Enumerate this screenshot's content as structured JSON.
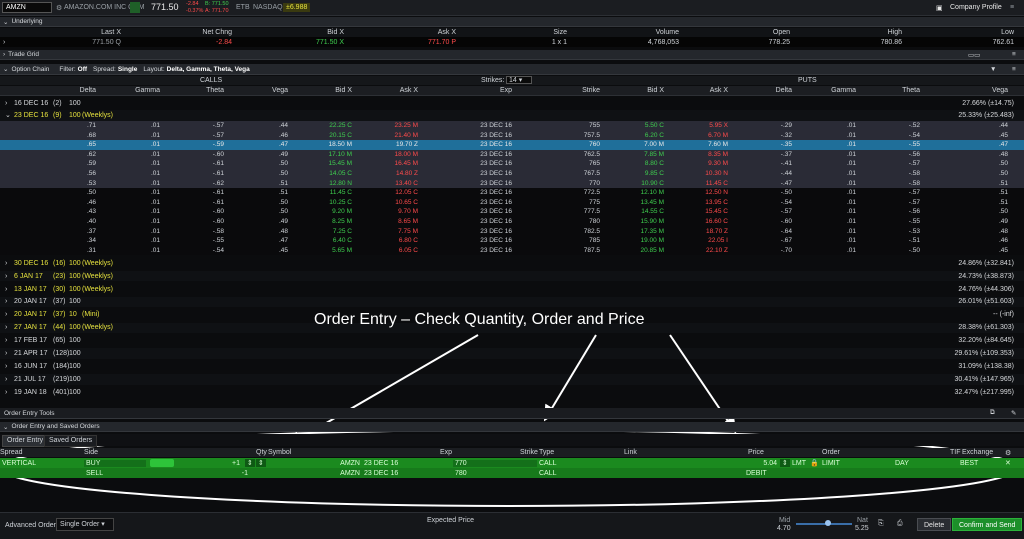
{
  "topbar": {
    "symbol": "AMZN",
    "company": "AMAZON.COM INC COM",
    "last": "771.50",
    "change_line1": "-2.84",
    "change_line2": "-0.37%",
    "bid_small": "B: 771.50",
    "ask_small": "A: 771.70",
    "etb": "ETB",
    "exchange": "NASDAQ",
    "pl_badge": "±6.988",
    "company_profile": "Company Profile"
  },
  "underlying": {
    "title": "Underlying",
    "headers": [
      "Last X",
      "Net Chng",
      "Bid X",
      "Ask X",
      "Size",
      "Volume",
      "Open",
      "High",
      "Low"
    ],
    "values": [
      "771.50 Q",
      "-2.84",
      "771.50 X",
      "771.70 P",
      "1 x 1",
      "4,768,053",
      "778.25",
      "780.86",
      "762.61"
    ]
  },
  "trade_grid": {
    "title": "Trade Grid"
  },
  "option_chain": {
    "title": "Option Chain",
    "filter_label": "Filter:",
    "filter_value": "Off",
    "spread_label": "Spread:",
    "spread_value": "Single",
    "layout_label": "Layout:",
    "layout_value": "Delta, Gamma, Theta, Vega",
    "calls_label": "CALLS",
    "puts_label": "PUTS",
    "strikes_label": "Strikes:",
    "strikes_value": "14",
    "call_headers": [
      "Delta",
      "Gamma",
      "Theta",
      "Vega",
      "Bid X",
      "Ask X"
    ],
    "mid_headers": [
      "Exp",
      "Strike"
    ],
    "put_headers": [
      "Bid X",
      "Ask X",
      "Delta",
      "Gamma",
      "Theta",
      "Vega"
    ]
  },
  "expirations_top": [
    {
      "label": "16 DEC 16",
      "days": "(2)",
      "mult": "100",
      "tag": "",
      "iv": "27.66% (±14.75)"
    },
    {
      "label": "23 DEC 16",
      "days": "(9)",
      "mult": "100",
      "tag": "(Weeklys)",
      "iv": "25.33% (±25.483)"
    }
  ],
  "chain_rows": [
    {
      "cd": ".71",
      "cg": ".01",
      "ct": "-.57",
      "cv": ".44",
      "cb": "22.25 C",
      "ca": "23.25 M",
      "exp": "23 DEC 16",
      "k": "755",
      "pb": "5.50 C",
      "pa": "5.95 X",
      "pd": "-.29",
      "pg": ".01",
      "pt": "-.52",
      "pv": ".44",
      "state": "itm"
    },
    {
      "cd": ".68",
      "cg": ".01",
      "ct": "-.57",
      "cv": ".46",
      "cb": "20.15 C",
      "ca": "21.40 M",
      "exp": "23 DEC 16",
      "k": "757.5",
      "pb": "6.20 C",
      "pa": "6.70 M",
      "pd": "-.32",
      "pg": ".01",
      "pt": "-.54",
      "pv": ".45",
      "state": "itm"
    },
    {
      "cd": ".65",
      "cg": ".01",
      "ct": "-.59",
      "cv": ".47",
      "cb": "18.50 M",
      "ca": "19.70 Z",
      "exp": "23 DEC 16",
      "k": "760",
      "pb": "7.00 M",
      "pa": "7.60 M",
      "pd": "-.35",
      "pg": ".01",
      "pt": "-.55",
      "pv": ".47",
      "state": "sel"
    },
    {
      "cd": ".62",
      "cg": ".01",
      "ct": "-.60",
      "cv": ".49",
      "cb": "17.10 M",
      "ca": "18.00 M",
      "exp": "23 DEC 16",
      "k": "762.5",
      "pb": "7.85 M",
      "pa": "8.35 M",
      "pd": "-.37",
      "pg": ".01",
      "pt": "-.56",
      "pv": ".48",
      "state": "itm"
    },
    {
      "cd": ".59",
      "cg": ".01",
      "ct": "-.61",
      "cv": ".50",
      "cb": "15.45 M",
      "ca": "16.45 M",
      "exp": "23 DEC 16",
      "k": "765",
      "pb": "8.80 C",
      "pa": "9.30 M",
      "pd": "-.41",
      "pg": ".01",
      "pt": "-.57",
      "pv": ".50",
      "state": "itm"
    },
    {
      "cd": ".56",
      "cg": ".01",
      "ct": "-.61",
      "cv": ".50",
      "cb": "14.05 C",
      "ca": "14.80 Z",
      "exp": "23 DEC 16",
      "k": "767.5",
      "pb": "9.85 C",
      "pa": "10.30 N",
      "pd": "-.44",
      "pg": ".01",
      "pt": "-.58",
      "pv": ".50",
      "state": "itm"
    },
    {
      "cd": ".53",
      "cg": ".01",
      "ct": "-.62",
      "cv": ".51",
      "cb": "12.80 N",
      "ca": "13.40 C",
      "exp": "23 DEC 16",
      "k": "770",
      "pb": "10.90 C",
      "pa": "11.45 C",
      "pd": "-.47",
      "pg": ".01",
      "pt": "-.58",
      "pv": ".51",
      "state": "itm"
    },
    {
      "cd": ".50",
      "cg": ".01",
      "ct": "-.61",
      "cv": ".51",
      "cb": "11.45 C",
      "ca": "12.05 C",
      "exp": "23 DEC 16",
      "k": "772.5",
      "pb": "12.10 M",
      "pa": "12.50 N",
      "pd": "-.50",
      "pg": ".01",
      "pt": "-.57",
      "pv": ".51",
      "state": "otm"
    },
    {
      "cd": ".46",
      "cg": ".01",
      "ct": "-.61",
      "cv": ".50",
      "cb": "10.25 C",
      "ca": "10.65 C",
      "exp": "23 DEC 16",
      "k": "775",
      "pb": "13.45 M",
      "pa": "13.95 C",
      "pd": "-.54",
      "pg": ".01",
      "pt": "-.57",
      "pv": ".51",
      "state": "otm"
    },
    {
      "cd": ".43",
      "cg": ".01",
      "ct": "-.60",
      "cv": ".50",
      "cb": "9.20 M",
      "ca": "9.70 M",
      "exp": "23 DEC 16",
      "k": "777.5",
      "pb": "14.55 C",
      "pa": "15.45 C",
      "pd": "-.57",
      "pg": ".01",
      "pt": "-.56",
      "pv": ".50",
      "state": "otm"
    },
    {
      "cd": ".40",
      "cg": ".01",
      "ct": "-.60",
      "cv": ".49",
      "cb": "8.25 M",
      "ca": "8.65 M",
      "exp": "23 DEC 16",
      "k": "780",
      "pb": "15.90 M",
      "pa": "16.60 C",
      "pd": "-.60",
      "pg": ".01",
      "pt": "-.55",
      "pv": ".49",
      "state": "otm"
    },
    {
      "cd": ".37",
      "cg": ".01",
      "ct": "-.58",
      "cv": ".48",
      "cb": "7.25 C",
      "ca": "7.75 M",
      "exp": "23 DEC 16",
      "k": "782.5",
      "pb": "17.35 M",
      "pa": "18.70 Z",
      "pd": "-.64",
      "pg": ".01",
      "pt": "-.53",
      "pv": ".48",
      "state": "otm"
    },
    {
      "cd": ".34",
      "cg": ".01",
      "ct": "-.55",
      "cv": ".47",
      "cb": "6.40 C",
      "ca": "6.80 C",
      "exp": "23 DEC 16",
      "k": "785",
      "pb": "19.00 M",
      "pa": "22.05 I",
      "pd": "-.67",
      "pg": ".01",
      "pt": "-.51",
      "pv": ".46",
      "state": "otm"
    },
    {
      "cd": ".31",
      "cg": ".01",
      "ct": "-.54",
      "cv": ".45",
      "cb": "5.65 M",
      "ca": "6.05 C",
      "exp": "23 DEC 16",
      "k": "787.5",
      "pb": "20.85 M",
      "pa": "22.10 Z",
      "pd": "-.70",
      "pg": ".01",
      "pt": "-.50",
      "pv": ".45",
      "state": "otm"
    }
  ],
  "expirations_bottom": [
    {
      "label": "30 DEC 16",
      "days": "(16)",
      "mult": "100",
      "tag": "(Weeklys)",
      "iv": "24.86% (±32.841)"
    },
    {
      "label": "6 JAN 17",
      "days": "(23)",
      "mult": "100",
      "tag": "(Weeklys)",
      "iv": "24.73% (±38.873)"
    },
    {
      "label": "13 JAN 17",
      "days": "(30)",
      "mult": "100",
      "tag": "(Weeklys)",
      "iv": "24.76% (±44.306)"
    },
    {
      "label": "20 JAN 17",
      "days": "(37)",
      "mult": "100",
      "tag": "",
      "iv": "26.01% (±51.603)"
    },
    {
      "label": "20 JAN 17",
      "days": "(37)",
      "mult": "10",
      "tag": "(Mini)",
      "iv": "-- (-inf)"
    },
    {
      "label": "27 JAN 17",
      "days": "(44)",
      "mult": "100",
      "tag": "(Weeklys)",
      "iv": "28.38% (±61.303)"
    },
    {
      "label": "17 FEB 17",
      "days": "(65)",
      "mult": "100",
      "tag": "",
      "iv": "32.20% (±84.645)"
    },
    {
      "label": "21 APR 17",
      "days": "(128)",
      "mult": "100",
      "tag": "",
      "iv": "29.61% (±109.353)"
    },
    {
      "label": "16 JUN 17",
      "days": "(184)",
      "mult": "100",
      "tag": "",
      "iv": "31.09% (±138.38)"
    },
    {
      "label": "21 JUL 17",
      "days": "(219)",
      "mult": "100",
      "tag": "",
      "iv": "30.41% (±147.965)"
    },
    {
      "label": "19 JAN 18",
      "days": "(401)",
      "mult": "100",
      "tag": "",
      "iv": "32.47% (±217.995)"
    }
  ],
  "annotation": "Order Entry – Check Quantity, Order and Price",
  "order_entry": {
    "tools_title": "Order Entry Tools",
    "saved_title": "Order Entry and Saved Orders",
    "tab_order_entry": "Order Entry",
    "tab_saved": "Saved Orders",
    "headers": [
      "Spread",
      "Side",
      "Qty",
      "Symbol",
      "Exp",
      "Strike",
      "Type",
      "Link",
      "Price",
      "Order",
      "TIF",
      "Exchange"
    ],
    "leg1": {
      "spread": "VERTICAL",
      "side": "BUY",
      "qty": "+1",
      "symbol": "AMZN",
      "exp": "23 DEC 16",
      "strike": "770",
      "type": "CALL",
      "price": "5.04",
      "lmt": "LMT",
      "order": "LIMIT",
      "tif": "DAY",
      "exchange": "BEST"
    },
    "leg2": {
      "side": "SELL",
      "qty": "-1",
      "symbol": "AMZN",
      "exp": "23 DEC 16",
      "strike": "780",
      "type": "CALL",
      "debit": "DEBIT"
    }
  },
  "footer": {
    "advanced_label": "Advanced Order:",
    "advanced_value": "Single Order",
    "expected_price": "Expected  Price",
    "mid_label": "Mid",
    "mid_value": "4.70",
    "nat_label": "Nat",
    "nat_value": "5.25",
    "delete": "Delete",
    "confirm": "Confirm and Send"
  },
  "colors": {
    "accent_green": "#1b8a1f",
    "bid_green": "#3fcf4f",
    "ask_red": "#ff4b4b",
    "weekly_yellow": "#e6e23e",
    "selected_blue": "#1f6f9a"
  }
}
